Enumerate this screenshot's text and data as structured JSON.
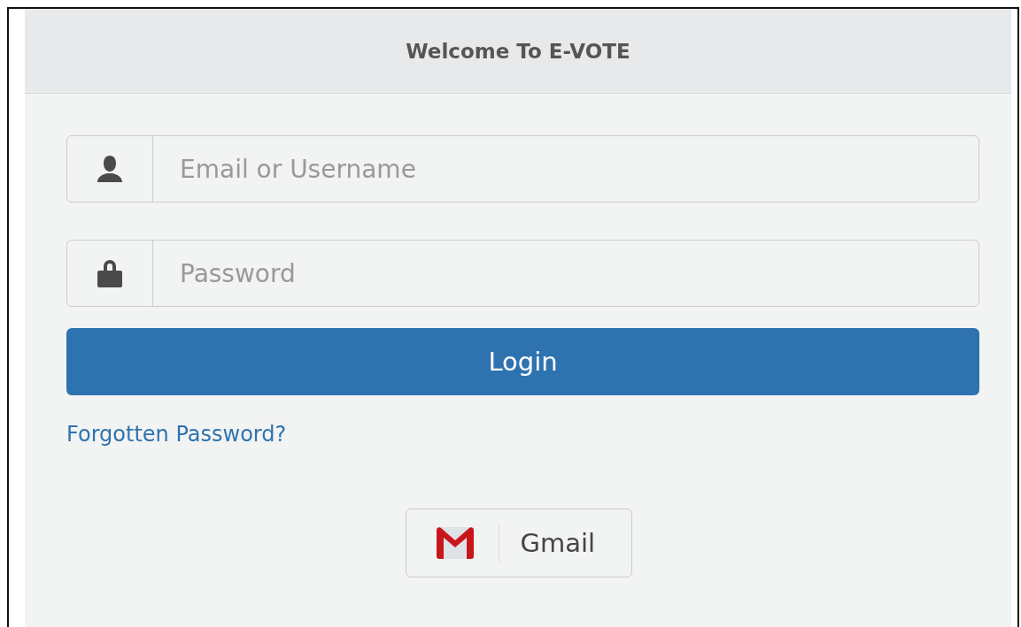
{
  "panel": {
    "title": "Welcome To E-VOTE"
  },
  "fields": [
    {
      "kind": "user",
      "placeholder": "Email or Username"
    },
    {
      "kind": "lock",
      "placeholder": "Password"
    }
  ],
  "login_button": "Login",
  "forgot_link": "Forgotten Password?",
  "social_button": {
    "label": "Gmail"
  }
}
